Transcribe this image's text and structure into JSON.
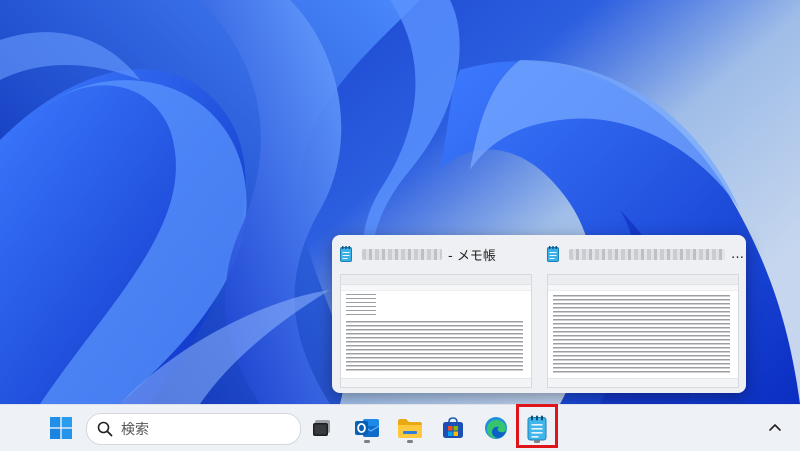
{
  "preview": {
    "left_window": {
      "title_suffix": "- メモ帳",
      "app": "notepad"
    },
    "right_window": {
      "title_suffix": "…",
      "app": "notepad"
    }
  },
  "taskbar": {
    "search_placeholder": "検索",
    "items": [
      {
        "name": "start",
        "icon": "windows-logo-icon"
      },
      {
        "name": "search",
        "icon": "search-icon"
      },
      {
        "name": "task-view",
        "icon": "task-view-icon"
      },
      {
        "name": "outlook",
        "icon": "outlook-icon"
      },
      {
        "name": "file-explorer",
        "icon": "folder-icon"
      },
      {
        "name": "microsoft-store",
        "icon": "store-icon"
      },
      {
        "name": "edge",
        "icon": "edge-icon"
      },
      {
        "name": "notepad",
        "icon": "notepad-icon",
        "highlighted": true
      }
    ],
    "tray_chevron_icon": "chevron-up-icon"
  },
  "colors": {
    "highlight": "#e0141b",
    "taskbar": "#eef1f6",
    "wallpaper_blue": "#1a4fd8"
  }
}
